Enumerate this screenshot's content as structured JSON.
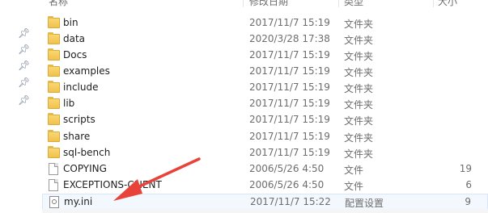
{
  "columns": {
    "name": "名称",
    "date": "修改日期",
    "type": "类型",
    "size": "大小"
  },
  "rows": [
    {
      "name": "bin",
      "date": "2017/11/7 15:19",
      "type": "文件夹",
      "size": "",
      "icon": "folder-icon"
    },
    {
      "name": "data",
      "date": "2020/3/28 17:38",
      "type": "文件夹",
      "size": "",
      "icon": "folder-icon"
    },
    {
      "name": "Docs",
      "date": "2017/11/7 15:19",
      "type": "文件夹",
      "size": "",
      "icon": "folder-icon"
    },
    {
      "name": "examples",
      "date": "2017/11/7 15:19",
      "type": "文件夹",
      "size": "",
      "icon": "folder-icon"
    },
    {
      "name": "include",
      "date": "2017/11/7 15:19",
      "type": "文件夹",
      "size": "",
      "icon": "folder-icon"
    },
    {
      "name": "lib",
      "date": "2017/11/7 15:19",
      "type": "文件夹",
      "size": "",
      "icon": "folder-icon"
    },
    {
      "name": "scripts",
      "date": "2017/11/7 15:19",
      "type": "文件夹",
      "size": "",
      "icon": "folder-icon"
    },
    {
      "name": "share",
      "date": "2017/11/7 15:19",
      "type": "文件夹",
      "size": "",
      "icon": "folder-icon"
    },
    {
      "name": "sql-bench",
      "date": "2017/11/7 15:19",
      "type": "文件夹",
      "size": "",
      "icon": "folder-icon"
    },
    {
      "name": "COPYING",
      "date": "2006/5/26 4:50",
      "type": "文件",
      "size": "19",
      "icon": "file-icon"
    },
    {
      "name": "EXCEPTIONS-CLIENT",
      "date": "2006/5/26 4:50",
      "type": "文件",
      "size": "6",
      "icon": "file-icon"
    },
    {
      "name": "my.ini",
      "date": "2017/11/7 15:22",
      "type": "配置设置",
      "size": "9",
      "icon": "ini-icon"
    }
  ],
  "selected_row": "my.ini",
  "annotation": {
    "arrow_color": "#e8433a",
    "icon": "red-arrow-icon"
  },
  "pins": [
    "pin-icon",
    "pin-icon",
    "pin-icon",
    "pin-icon",
    "pin-icon"
  ]
}
